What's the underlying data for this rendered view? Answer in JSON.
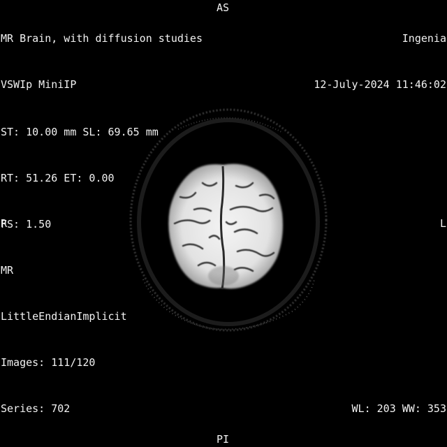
{
  "overlay": {
    "top_left": {
      "study": "MR Brain, with diffusion studies",
      "series_desc": "VSWIp MiniIP"
    },
    "top_right": {
      "institution": "Ingenia",
      "datetime": "12-July-2024 11:46:02"
    },
    "bottom_left": {
      "thickness_location": "ST: 10.00 mm SL: 69.65 mm",
      "timing": "RT: 51.26 ET: 0.00",
      "field_strength": "FS: 1.50",
      "modality": "MR",
      "transfer_syntax": "LittleEndianImplicit",
      "images": "Images: 111/120",
      "series": "Series: 702"
    },
    "bottom_right": {
      "window": "WL: 203 WW: 353"
    },
    "orientation": {
      "top": "AS",
      "left": "R",
      "right": "L",
      "bottom": "PI"
    }
  },
  "image": {
    "description_icon": "mri-brain-axial-slice"
  }
}
